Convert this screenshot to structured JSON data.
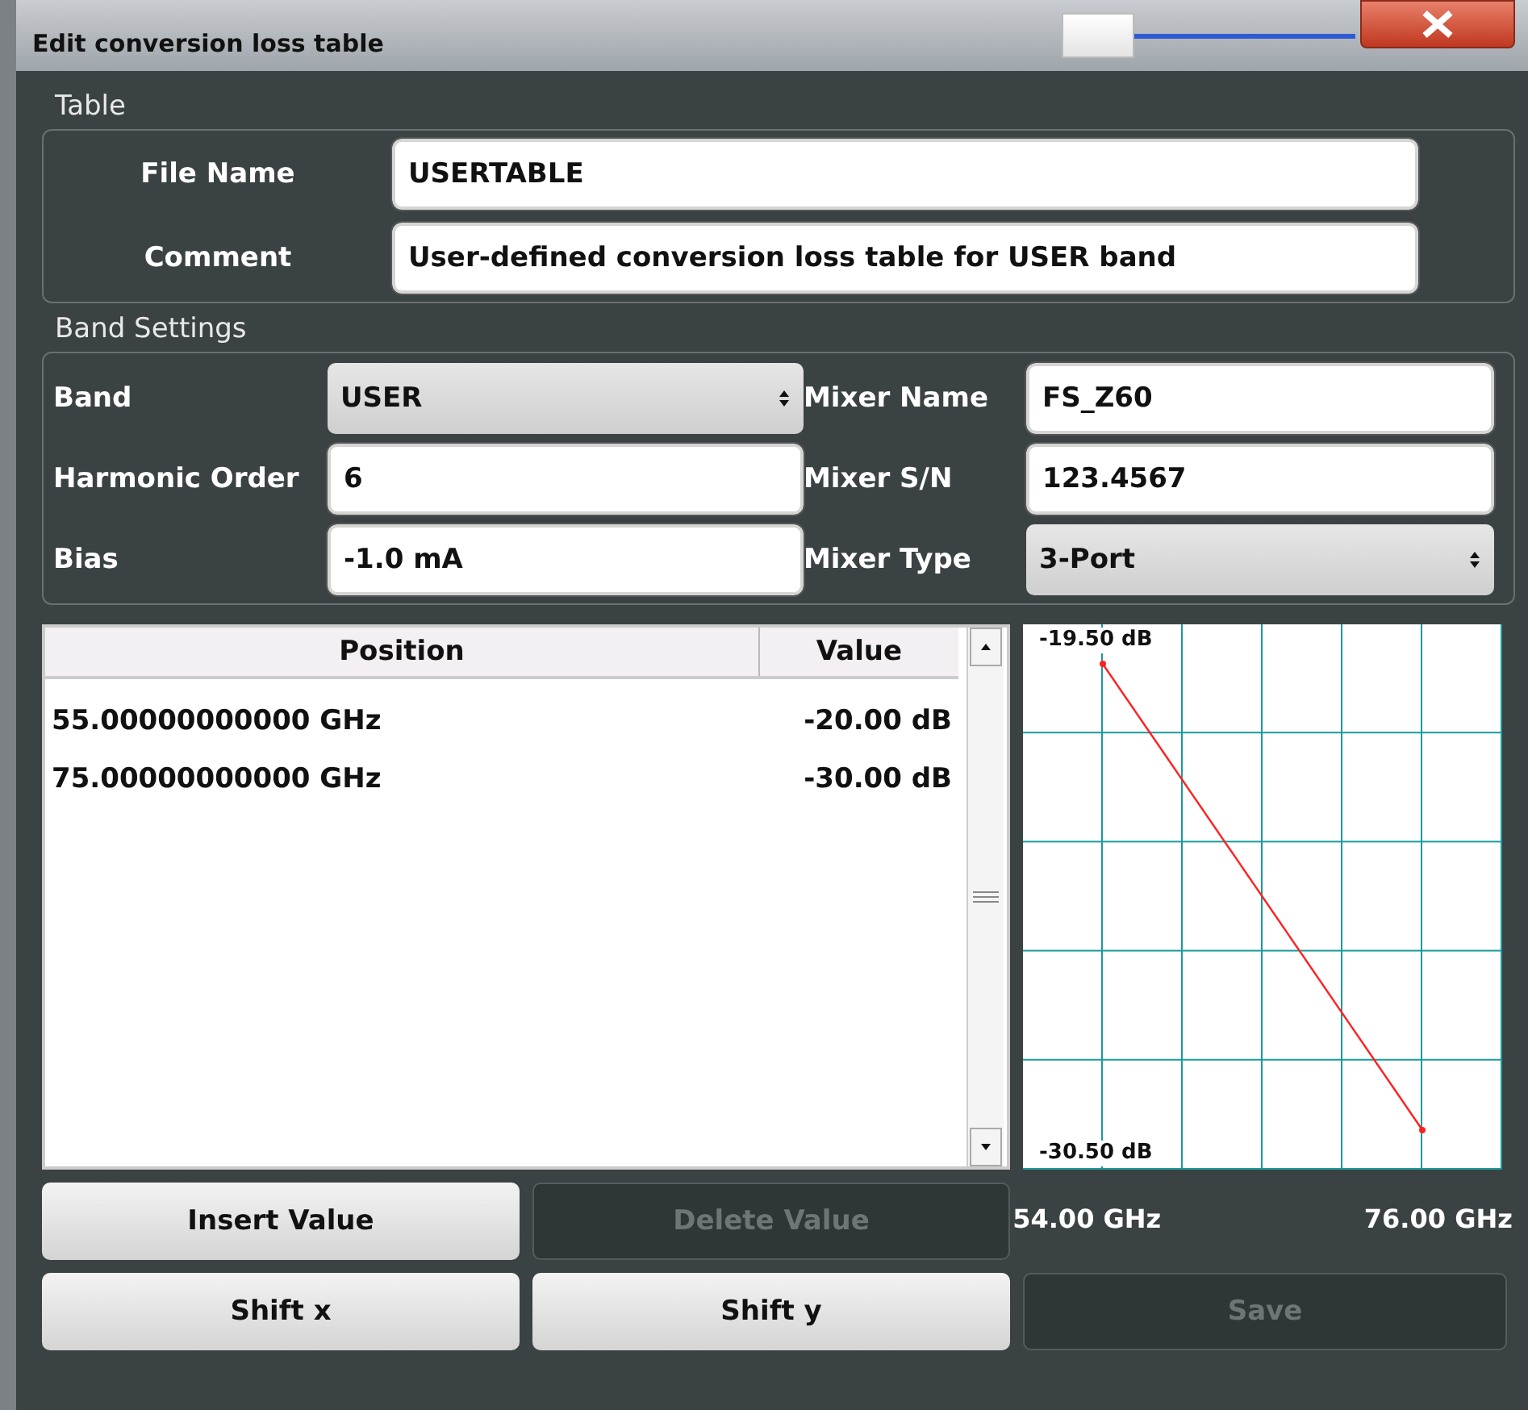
{
  "window": {
    "title": "Edit conversion loss table",
    "transparency_slider": {
      "level": 0.05
    }
  },
  "table_group": {
    "title": "Table",
    "fields": [
      {
        "label": "File Name",
        "value": "USERTABLE"
      },
      {
        "label": "Comment",
        "value": "User-defined conversion loss table for USER band"
      }
    ]
  },
  "band_settings": {
    "title": "Band Settings",
    "fields": [
      {
        "label": "Band",
        "kind": "dropdown",
        "value": "USER"
      },
      {
        "label": "Mixer Name",
        "kind": "text",
        "value": "FS_Z60"
      },
      {
        "label": "Harmonic Order",
        "kind": "text",
        "value": "6"
      },
      {
        "label": "Mixer S/N",
        "kind": "text",
        "value": "123.4567"
      },
      {
        "label": "Bias",
        "kind": "text",
        "value": "-1.0 mA"
      },
      {
        "label": "Mixer Type",
        "kind": "dropdown",
        "value": "3-Port"
      }
    ]
  },
  "loss_table": {
    "columns": [
      "Position",
      "Value"
    ],
    "rows": [
      {
        "position": "55.00000000000 GHz",
        "value": "-20.00 dB"
      },
      {
        "position": "75.00000000000 GHz",
        "value": "-30.00 dB"
      }
    ]
  },
  "chart": {
    "chart_data": {
      "type": "line",
      "x": [
        55,
        75
      ],
      "series": [
        {
          "color": "#ff2020",
          "marker": "circle",
          "values": [
            -20,
            -30
          ]
        }
      ],
      "xlim": [
        50,
        80
      ],
      "ylim": [
        -30.85,
        -19.15
      ],
      "xticks": [
        {
          "value": 54,
          "label": "54.00 GHz"
        },
        {
          "value": 76,
          "label": "76.00 GHz"
        }
      ],
      "yticks": [
        {
          "value": -19.5,
          "label": "-19.50 dB"
        },
        {
          "value": -30.5,
          "label": "-30.50 dB"
        }
      ]
    }
  },
  "buttons": [
    {
      "label": "Insert Value",
      "disabled": false
    },
    {
      "label": "Delete Value",
      "disabled": true
    },
    {
      "label": "Shift x",
      "disabled": false
    },
    {
      "label": "Shift y",
      "disabled": false
    },
    {
      "label": "Save",
      "disabled": true
    }
  ]
}
